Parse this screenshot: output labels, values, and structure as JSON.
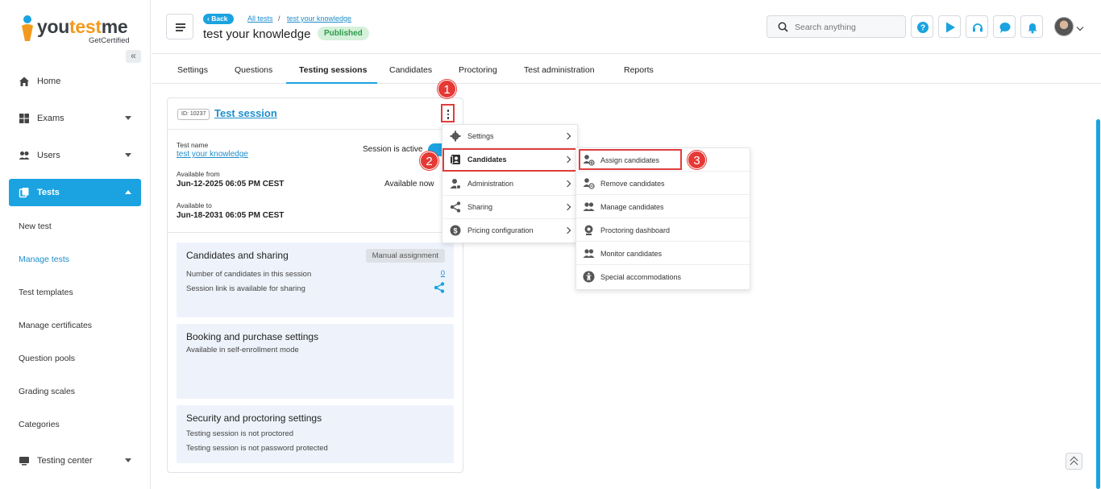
{
  "brand": {
    "name_part1": "you",
    "name_accent": "test",
    "name_part2": "me",
    "tagline": "GetCertified",
    "accent_color": "#1aa3e0"
  },
  "sidebar": {
    "items": [
      {
        "label": "Home",
        "icon": "home-icon"
      },
      {
        "label": "Exams",
        "icon": "exams-icon"
      },
      {
        "label": "Users",
        "icon": "users-icon"
      },
      {
        "label": "Tests",
        "icon": "tests-icon"
      },
      {
        "label": "Testing center",
        "icon": "testing-center-icon"
      }
    ],
    "subitems": [
      "New test",
      "Manage tests",
      "Test templates",
      "Manage certificates",
      "Question pools",
      "Grading scales",
      "Categories"
    ]
  },
  "header": {
    "back_label": "Back",
    "breadcrumb": [
      "All tests",
      "test your knowledge"
    ],
    "breadcrumb_sep": "/",
    "title": "test your knowledge",
    "status_badge": "Published",
    "search_placeholder": "Search anything"
  },
  "tabs": [
    "Settings",
    "Questions",
    "Testing sessions",
    "Candidates",
    "Proctoring",
    "Test administration",
    "Reports"
  ],
  "session": {
    "id_label": "ID: 10237",
    "title": "Test session",
    "test_name_label": "Test name",
    "test_name": "test your knowledge",
    "session_status": "Session is active",
    "available_from_label": "Available from",
    "available_from": "Jun-12-2025 06:05 PM CEST",
    "availability": "Available now",
    "available_to_label": "Available to",
    "available_to": "Jun-18-2031 06:05 PM CEST"
  },
  "sections": {
    "candidates": {
      "title": "Candidates and sharing",
      "badge": "Manual assignment",
      "line1": "Number of candidates in this session",
      "count": "0",
      "line2": "Session link is available for sharing"
    },
    "booking": {
      "title": "Booking and purchase settings",
      "line1": "Available in self-enrollment mode"
    },
    "security": {
      "title": "Security and proctoring settings",
      "line1": "Testing session is not proctored",
      "line2": "Testing session is not password protected"
    }
  },
  "menu": {
    "items": [
      {
        "label": "Settings",
        "icon": "gear-icon"
      },
      {
        "label": "Candidates",
        "icon": "candidates-icon"
      },
      {
        "label": "Administration",
        "icon": "administration-icon"
      },
      {
        "label": "Sharing",
        "icon": "share-icon"
      },
      {
        "label": "Pricing configuration",
        "icon": "dollar-icon"
      }
    ]
  },
  "submenu": {
    "items": [
      {
        "label": "Assign candidates",
        "icon": "assign-candidate-icon"
      },
      {
        "label": "Remove candidates",
        "icon": "remove-candidate-icon"
      },
      {
        "label": "Manage candidates",
        "icon": "manage-candidates-icon"
      },
      {
        "label": "Proctoring dashboard",
        "icon": "webcam-icon"
      },
      {
        "label": "Monitor candidates",
        "icon": "monitor-candidates-icon"
      },
      {
        "label": "Special accommodations",
        "icon": "accessibility-icon"
      }
    ]
  },
  "steps": [
    "1",
    "2",
    "3"
  ]
}
